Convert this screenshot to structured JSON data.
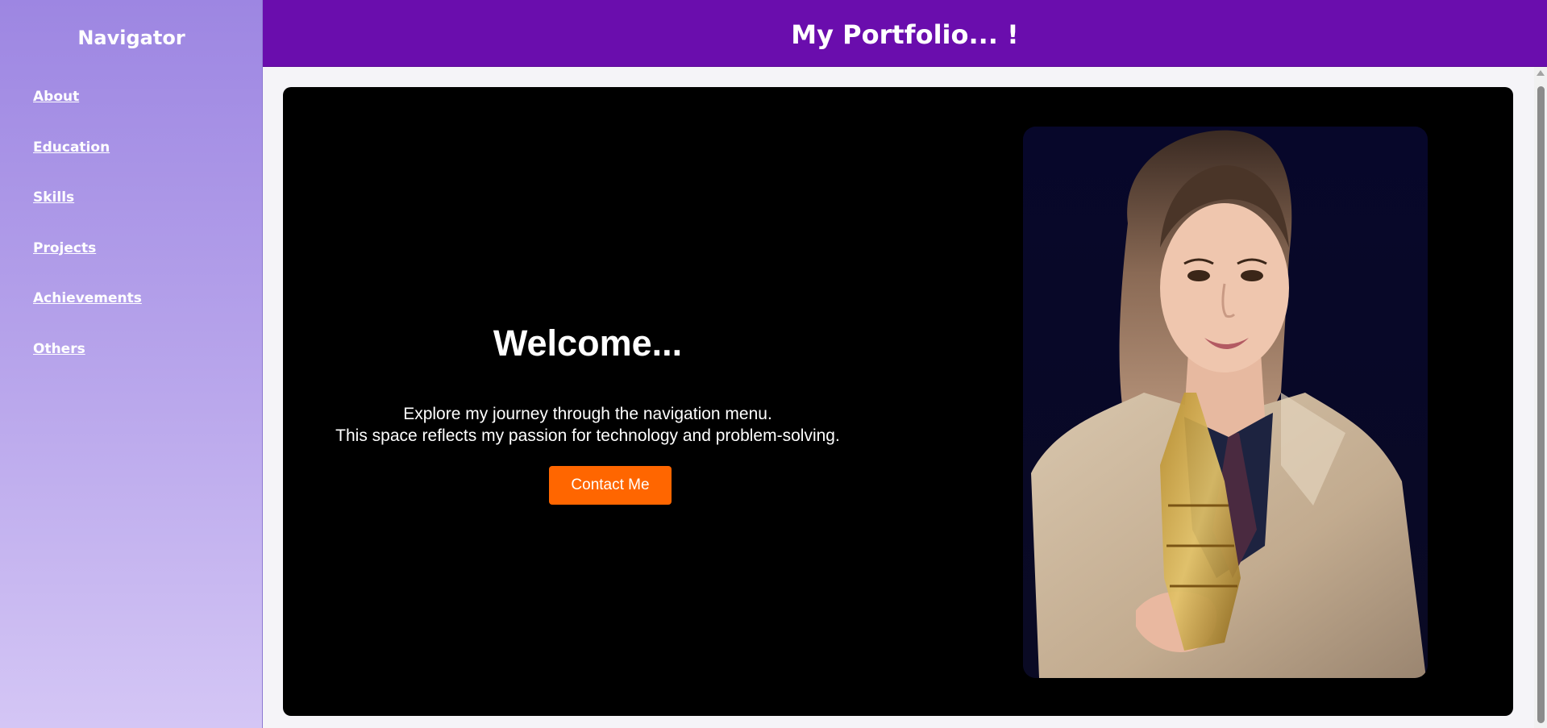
{
  "sidebar": {
    "title": "Navigator",
    "items": [
      {
        "label": "About"
      },
      {
        "label": "Education"
      },
      {
        "label": "Skills"
      },
      {
        "label": "Projects"
      },
      {
        "label": "Achievements"
      },
      {
        "label": "Others"
      }
    ]
  },
  "header": {
    "title": "My Portfolio... !"
  },
  "hero": {
    "heading": "Welcome...",
    "line1": "Explore my journey through the navigation menu.",
    "line2": "This space reflects my passion for technology and problem-solving.",
    "button_label": "Contact Me",
    "photo_alt": "Portrait"
  },
  "colors": {
    "header_bg": "#6a0dad",
    "sidebar_top": "#9d86e2",
    "sidebar_bottom": "#d4c6f5",
    "hero_bg": "#000000",
    "button_bg": "#ff6600"
  }
}
